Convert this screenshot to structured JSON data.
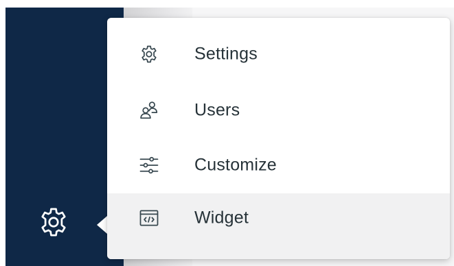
{
  "menu": {
    "items": [
      {
        "label": "Settings",
        "icon": "gear-icon"
      },
      {
        "label": "Users",
        "icon": "users-icon"
      },
      {
        "label": "Customize",
        "icon": "sliders-icon"
      },
      {
        "label": "Widget",
        "icon": "widget-code-icon"
      }
    ],
    "hovered_item": "Widget"
  },
  "sidebar": {
    "trigger_icon": "gear-icon"
  },
  "colors": {
    "sidebar_bg": "#0f2847",
    "menu_bg": "#ffffff",
    "hover_bg": "#f1f1f2",
    "text": "#263238",
    "icon_stroke": "#37474f"
  }
}
